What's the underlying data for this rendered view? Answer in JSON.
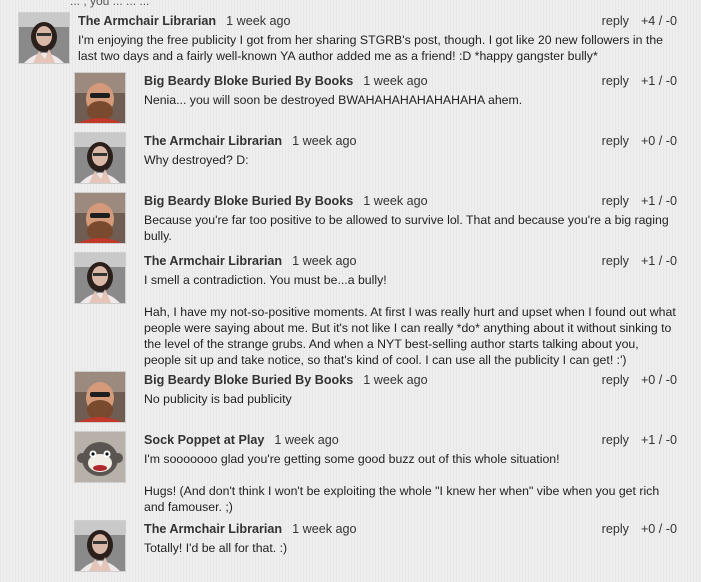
{
  "top_fragment": "... , you ... ... ...",
  "comments": [
    {
      "author": "The Armchair Librarian",
      "time": "1 week ago",
      "reply": "reply",
      "votes": "+4 / -0",
      "avatar": "librarian",
      "paragraphs": [
        "I'm enjoying the free publicity I got from her sharing STGRB's post, though. I got like 20 new followers in the last two days and a fairly well-known YA author added me as a friend! :D *happy gangster bully*"
      ]
    },
    {
      "author": "Big Beardy Bloke Buried By Books",
      "time": "1 week ago",
      "reply": "reply",
      "votes": "+1 / -0",
      "avatar": "beardy",
      "paragraphs": [
        "Nenia... you will soon be destroyed BWAHAHAHAHAHAHAHA ahem."
      ]
    },
    {
      "author": "The Armchair Librarian",
      "time": "1 week ago",
      "reply": "reply",
      "votes": "+0 / -0",
      "avatar": "librarian",
      "paragraphs": [
        "Why destroyed? D:"
      ]
    },
    {
      "author": "Big Beardy Bloke Buried By Books",
      "time": "1 week ago",
      "reply": "reply",
      "votes": "+1 / -0",
      "avatar": "beardy",
      "paragraphs": [
        "Because you're far too positive to be allowed to survive lol. That and because you're a big raging bully."
      ]
    },
    {
      "author": "The Armchair Librarian",
      "time": "1 week ago",
      "reply": "reply",
      "votes": "+1 / -0",
      "avatar": "librarian",
      "paragraphs": [
        "I smell a contradiction. You must be...a bully!",
        "Hah, I have my not-so-positive moments. At first I was really hurt and upset when I found out what people were saying about me. But it's not like I can really *do* anything about it without sinking to the level of the strange grubs. And when a NYT best-selling author starts talking about you, people sit up and take notice, so that's kind of cool. I can use all the publicity I can get! :')"
      ]
    },
    {
      "author": "Big Beardy Bloke Buried By Books",
      "time": "1 week ago",
      "reply": "reply",
      "votes": "+0 / -0",
      "avatar": "beardy",
      "paragraphs": [
        "No publicity is bad publicity"
      ]
    },
    {
      "author": "Sock Poppet at Play",
      "time": "1 week ago",
      "reply": "reply",
      "votes": "+1 / -0",
      "avatar": "sockmonkey",
      "paragraphs": [
        "I'm sooooooo glad you're getting some good buzz out of this whole situation!",
        "Hugs! (And don't think I won't be exploiting the whole \"I knew her when\" vibe when you get rich and famouser. ;)"
      ]
    },
    {
      "author": "The Armchair Librarian",
      "time": "1 week ago",
      "reply": "reply",
      "votes": "+0 / -0",
      "avatar": "librarian",
      "paragraphs": [
        "Totally! I'd be all for that. :)"
      ]
    }
  ]
}
